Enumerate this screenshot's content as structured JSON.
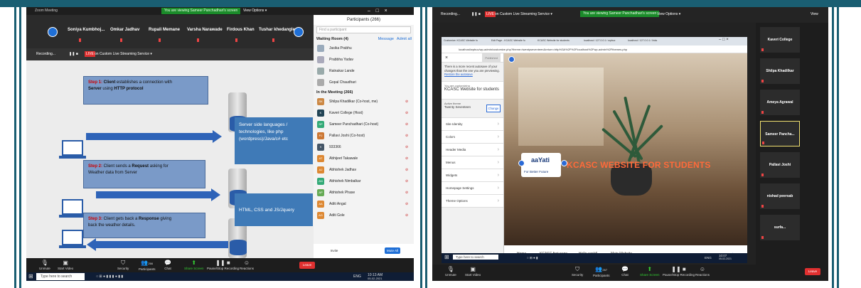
{
  "left": {
    "window_title": "Zoom Meeting",
    "share_banner": "You are viewing Sameer Panchadhari's screen",
    "view_options": "View Options ▾",
    "gallery": [
      "Soniya Kumbhoj...",
      "Omkar Jadhav",
      "Rupali Memane",
      "Varsha Narawade",
      "Firdous Khan",
      "Tushar khedangle"
    ],
    "rec_bar": {
      "recording": "Recording...",
      "live": "LIVE",
      "stream": "on Custom Live Streaming Service ▾"
    },
    "slide": {
      "step1": {
        "prefix": "Step 1: ",
        "bold1": "Client",
        "mid": " establishes a connection with",
        "bold2": "Server",
        "mid2": " using ",
        "bold3": "HTTP protocol"
      },
      "step2": {
        "prefix": "Step 2: ",
        "mid": "Client sends a ",
        "bold": "Request",
        "tail": " asking for",
        "line2": "Weather data from Server"
      },
      "step3": {
        "prefix": "Step 3: ",
        "mid": "Client gets back a ",
        "bold": "Response",
        "tail": " giving",
        "line2": "back the weather details."
      },
      "side1": "Server side languages / technologies, like php (wordpress)/Java/c# etc",
      "side2": "HTML, CSS and JS/Jquery"
    },
    "participants": {
      "title": "Participants (266)",
      "search_placeholder": "Find a participant",
      "waiting": "Waiting Room (4)",
      "message": "Message",
      "admit_all": "Admit all",
      "waiting_list": [
        {
          "name": "Jasika Prabhu",
          "color": "#9ab"
        },
        {
          "name": "Prabbha Yadav",
          "color": "#aab"
        },
        {
          "name": "Ratnakar Lande",
          "color": "#9aa"
        },
        {
          "name": "Gopal Chaudhari",
          "color": "#aaa"
        }
      ],
      "in_meeting": "In the Meeting (266)",
      "meeting_list": [
        {
          "name": "Shilpa Khadilkar (Co-host, me)",
          "av": "SK",
          "color": "#c84"
        },
        {
          "name": "Kaveri College (Host)",
          "av": "K",
          "color": "#245"
        },
        {
          "name": "Sameer Panchadhari (Co-host)",
          "av": "SP",
          "color": "#3a7"
        },
        {
          "name": "Pallavi Joshi (Co-host)",
          "av": "PJ",
          "color": "#c73"
        },
        {
          "name": "933366",
          "av": "9",
          "color": "#456"
        },
        {
          "name": "Abhijeet Takawale",
          "av": "AT",
          "color": "#d83"
        },
        {
          "name": "Abhishek Jadhav",
          "av": "AJ",
          "color": "#d83"
        },
        {
          "name": "Abhishek Nimbalkar",
          "av": "AN",
          "color": "#3a7"
        },
        {
          "name": "Abhishek Phase",
          "av": "AP",
          "color": "#6a5"
        },
        {
          "name": "Aditi Angal",
          "av": "AA",
          "color": "#d83"
        },
        {
          "name": "Aditi Gole",
          "av": "AG",
          "color": "#d83"
        }
      ],
      "invite": "Invite",
      "mute_all": "Mute All"
    },
    "toolbar": [
      "Unmute",
      "Start Video",
      "Security",
      "Participants",
      "Chat",
      "Share Screen",
      "Pause/Stop Recording",
      "Reactions"
    ],
    "participants_count": "266",
    "leave": "Leave",
    "taskbar_search": "Type here to search",
    "clock": "10:13 AM",
    "date": "05-02-2021",
    "lang": "ENG"
  },
  "right": {
    "rec_bar": {
      "recording": "Recording...",
      "live": "LIVE",
      "stream": "on Custom Live Streaming Service ▾"
    },
    "share_banner": "You are viewing Sameer Panchadhari's screen",
    "view_options": "View Options ▾",
    "view": "View",
    "browser_tabs": [
      "Customize: KCASC Website fo",
      "Edit Page - KCASC Website fo",
      "KCASC Website for students",
      "localhost / 127.0.0.1 / wpbuc",
      "localhost / 127.0.0.1 / links"
    ],
    "address": "localhost/wpbuc/wp-admin/customize.php?theme=twentyseventeen&return=http%3A%2F%2Flocalhost%2Fwp-admin%2Fthemes.php",
    "publish": "Published",
    "notice": "There is a more recent autosave of your changes than the one you are previewing.",
    "notice_link": "Restore the autosave",
    "customizing": "You are customizing",
    "site_title": "KCASC Website for students",
    "active_theme_label": "Active theme",
    "active_theme": "Twenty Seventeen",
    "change": "Change",
    "menu": [
      "Site Identity",
      "Colors",
      "Header Media",
      "Menus",
      "Widgets",
      "Homepage Settings",
      "Theme Options"
    ],
    "hide_controls": "Hide Controls",
    "hero_title": "KCASC WEBSITE FOR STUDENTS",
    "logo_name": "aaYati",
    "logo_tag": "For Better Future",
    "nav": [
      "Home",
      "KCASC first page",
      "Hello world!",
      "Main Website"
    ],
    "taskbar_search": "Type here to search",
    "clock": "10:07",
    "date": "05-02-2021",
    "lang": "ENG",
    "videos": [
      {
        "name": "Kaveri College",
        "active": false
      },
      {
        "name": "Shilpa Khadilkar",
        "active": false
      },
      {
        "name": "Ameya Agrawal",
        "active": false
      },
      {
        "name": "Sameer Pancha...",
        "active": true
      },
      {
        "name": "Pallavi Joshi",
        "active": false
      },
      {
        "name": "nishad peersab",
        "active": false
      },
      {
        "name": "surfa...",
        "active": false
      }
    ],
    "toolbar": [
      "Unmute",
      "Start Video",
      "Security",
      "Participants",
      "Chat",
      "Share Screen",
      "Pause/Stop Recording",
      "Reactions"
    ],
    "participants_count": "267",
    "leave": "Leave"
  },
  "colors": {
    "frame": "#1a5e72",
    "zoom_blue": "#1f6fd6",
    "live_red": "#e03030",
    "banner_green": "#1b8b2a",
    "slide_blue": "#2e63b8",
    "kcasc_orange": "#ff6a3a"
  }
}
